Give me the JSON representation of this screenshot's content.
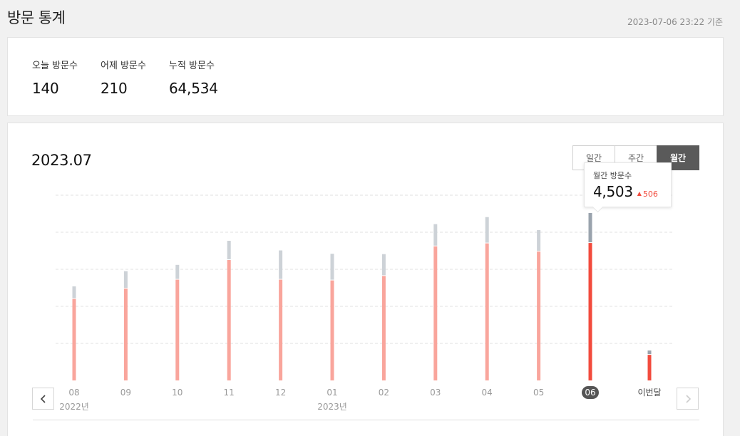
{
  "header": {
    "title": "방문 통계",
    "timestamp": "2023-07-06 23:22 기준"
  },
  "summary": {
    "stats": [
      {
        "label": "오늘 방문수",
        "value": "140"
      },
      {
        "label": "어제 방문수",
        "value": "210"
      },
      {
        "label": "누적 방문수",
        "value": "64,534"
      }
    ]
  },
  "chart_panel": {
    "period_title": "2023.07",
    "tabs": [
      {
        "label": "일간",
        "active": false
      },
      {
        "label": "주간",
        "active": false
      },
      {
        "label": "월간",
        "active": true
      }
    ],
    "prev_icon": "chevron-left-icon",
    "next_icon": "chevron-right-icon"
  },
  "tooltip": {
    "label": "월간 방문수",
    "value": "4,503",
    "delta": "506",
    "delta_icon": "triangle-up-icon"
  },
  "chart_data": {
    "type": "bar",
    "categories": [
      "08",
      "09",
      "10",
      "11",
      "12",
      "01",
      "02",
      "03",
      "04",
      "05",
      "06",
      "이번달"
    ],
    "year_labels": [
      {
        "text": "2022년",
        "at": "08"
      },
      {
        "text": "2023년",
        "at": "01"
      }
    ],
    "series": [
      {
        "values": [
          2200,
          2480,
          2720,
          3250,
          2720,
          2700,
          2820,
          3620,
          3700,
          3480,
          3710,
          690
        ],
        "color": "#f9a59c",
        "highlight_color": "#f24b3d"
      },
      {
        "values": [
          320,
          450,
          380,
          500,
          770,
          700,
          570,
          580,
          690,
          560,
          790,
          100
        ],
        "color": "#cdd2d7",
        "highlight_color": "#9aa3ad"
      }
    ],
    "highlight_categories": [
      "06",
      "이번달"
    ],
    "selected_category": "06",
    "ylim": [
      0,
      5000
    ],
    "grid": true,
    "legend": "none"
  },
  "colors": {
    "accent_red": "#f24b3d",
    "bar_pink": "#f9a59c",
    "bar_gray": "#cdd2d7",
    "active_tab": "#5a5a5a"
  }
}
